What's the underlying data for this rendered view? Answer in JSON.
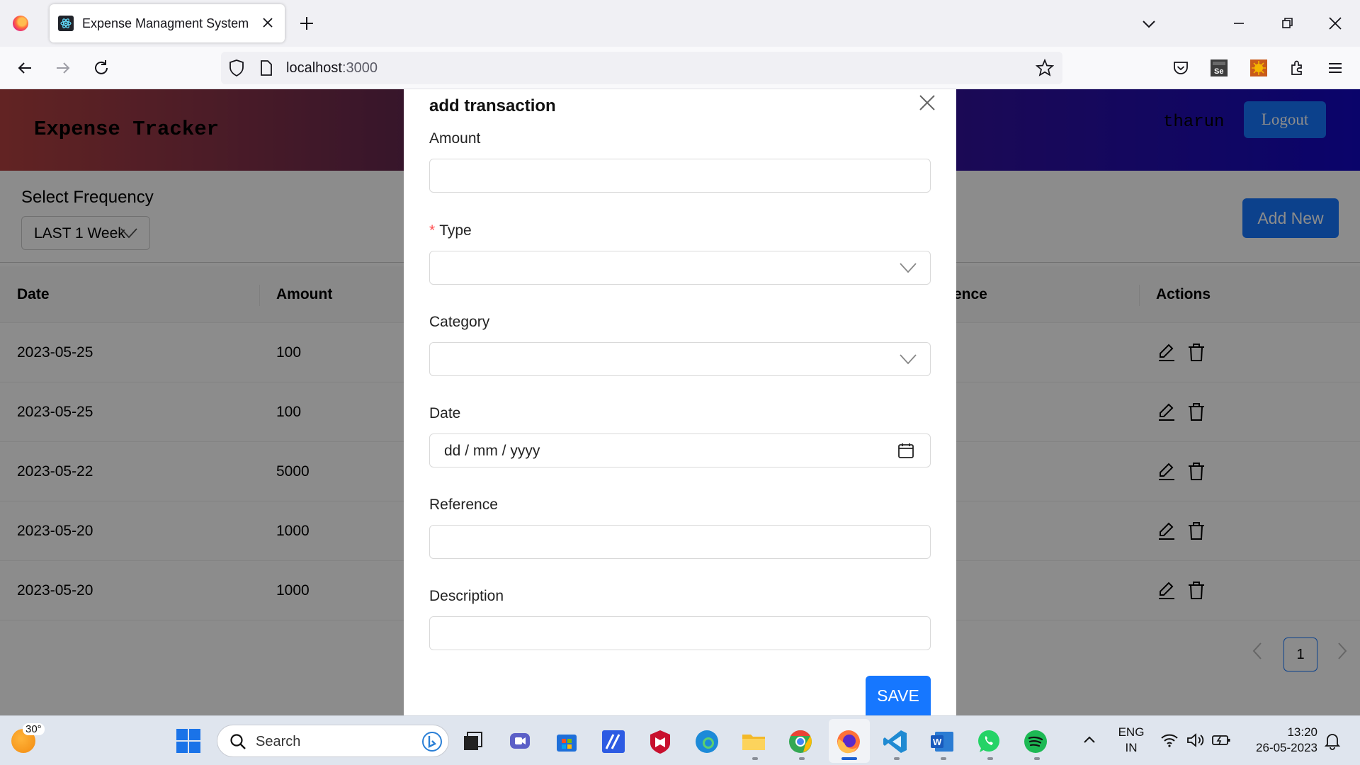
{
  "browser": {
    "tab_title": "Expense Managment System",
    "url_host": "localhost",
    "url_port": ":3000"
  },
  "app": {
    "brand": "Expense Tracker",
    "username": "tharun",
    "logout_label": "Logout",
    "frequency_label": "Select Frequency",
    "frequency_value": "LAST 1 Week",
    "add_new_label": "Add New"
  },
  "table": {
    "headers": {
      "date": "Date",
      "amount": "Amount",
      "reference_partial": "ence",
      "actions": "Actions"
    },
    "rows": [
      {
        "date": "2023-05-25",
        "amount": "100"
      },
      {
        "date": "2023-05-25",
        "amount": "100"
      },
      {
        "date": "2023-05-22",
        "amount": "5000"
      },
      {
        "date": "2023-05-20",
        "amount": "1000"
      },
      {
        "date": "2023-05-20",
        "amount": "1000"
      }
    ]
  },
  "pagination": {
    "current_page": "1"
  },
  "modal": {
    "title": "add transaction",
    "amount_label": "Amount",
    "amount_value": "",
    "type_required_mark": "*",
    "type_label": "Type",
    "type_value": "",
    "category_label": "Category",
    "category_value": "",
    "date_label": "Date",
    "date_placeholder": "dd / mm / yyyy",
    "reference_label": "Reference",
    "reference_value": "",
    "description_label": "Description",
    "description_value": "",
    "save_label": "SAVE"
  },
  "taskbar": {
    "temperature": "30°",
    "search_label": "Search",
    "language_line1": "ENG",
    "language_line2": "IN",
    "time": "13:20",
    "date": "26-05-2023"
  },
  "colors": {
    "primary": "#1677ff",
    "header_gradient_start": "#b34140",
    "header_gradient_end": "#1308c2",
    "required": "#ff4d4f"
  },
  "icons": [
    "firefox-icon",
    "react-favicon-icon",
    "close-icon",
    "plus-icon",
    "chevron-down-icon",
    "minimize-icon",
    "restore-icon",
    "back-icon",
    "forward-icon",
    "reload-icon",
    "shield-icon",
    "page-icon",
    "star-icon",
    "pocket-icon",
    "selenium-icon",
    "extension-icon",
    "puzzle-icon",
    "menu-icon",
    "edit-icon",
    "delete-icon",
    "calendar-icon",
    "windows-start-icon",
    "search-icon",
    "bing-icon"
  ]
}
